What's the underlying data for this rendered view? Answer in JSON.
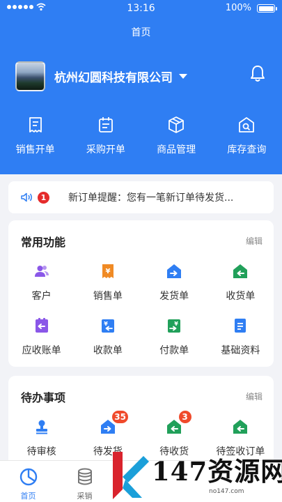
{
  "status_bar": {
    "time": "13:16",
    "battery": "100%"
  },
  "nav": {
    "title": "首页"
  },
  "company": {
    "name": "杭州幻圆科技有限公司"
  },
  "quick_actions": [
    {
      "label": "销售开单",
      "icon": "receipt-icon"
    },
    {
      "label": "采购开单",
      "icon": "purchase-order-icon"
    },
    {
      "label": "商品管理",
      "icon": "box-icon"
    },
    {
      "label": "库存查询",
      "icon": "warehouse-search-icon"
    }
  ],
  "notice": {
    "count": "1",
    "text": "新订单提醒：您有一笔新订单待发货..."
  },
  "common": {
    "title": "常用功能",
    "edit": "编辑",
    "items": [
      {
        "label": "客户",
        "icon": "customer-icon"
      },
      {
        "label": "销售单",
        "icon": "sales-order-icon"
      },
      {
        "label": "发货单",
        "icon": "shipping-icon"
      },
      {
        "label": "收货单",
        "icon": "receiving-icon"
      },
      {
        "label": "应收账单",
        "icon": "receivable-icon"
      },
      {
        "label": "收款单",
        "icon": "collection-icon"
      },
      {
        "label": "付款单",
        "icon": "payment-icon"
      },
      {
        "label": "基础资料",
        "icon": "document-icon"
      }
    ]
  },
  "todo": {
    "title": "待办事项",
    "edit": "编辑",
    "items": [
      {
        "label": "待审核",
        "icon": "stamp-icon",
        "count": ""
      },
      {
        "label": "待发货",
        "icon": "shipping-icon",
        "count": "35"
      },
      {
        "label": "待收货",
        "icon": "receiving-icon",
        "count": "3"
      },
      {
        "label": "待签收订单",
        "icon": "receiving-icon",
        "count": ""
      }
    ]
  },
  "tabs": [
    {
      "label": "首页",
      "icon": "home-chart-icon",
      "active": true
    },
    {
      "label": "采销",
      "icon": "database-icon",
      "active": false
    }
  ],
  "watermark": {
    "text": "147资源网",
    "url": "no147.com"
  },
  "colors": {
    "primary": "#2f7ef3",
    "badge": "#e52b2b",
    "purple": "#8a57e8",
    "orange": "#f08a24",
    "blue": "#2f7ef3",
    "green": "#21a05a"
  }
}
